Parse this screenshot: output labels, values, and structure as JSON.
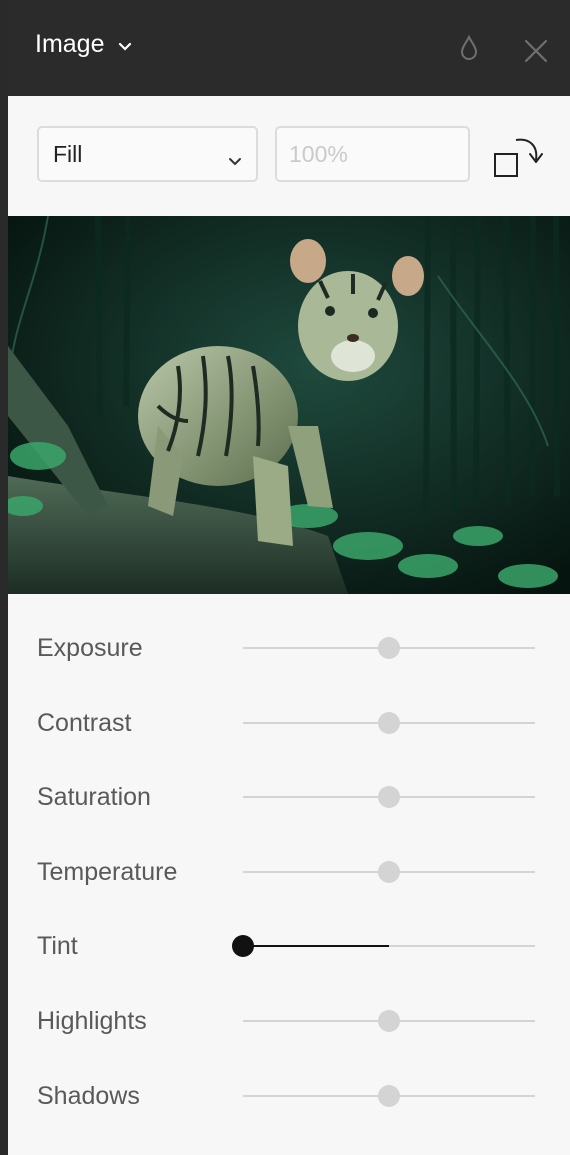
{
  "header": {
    "title": "Image",
    "icons": [
      "chevron-down-icon",
      "droplet-icon",
      "close-icon"
    ]
  },
  "controls": {
    "fill_mode": "Fill",
    "fill_options_visible": [
      "Fill"
    ],
    "percent_placeholder": "100%"
  },
  "adjustments": [
    {
      "label": "Exposure",
      "value": 0.5
    },
    {
      "label": "Contrast",
      "value": 0.5
    },
    {
      "label": "Saturation",
      "value": 0.5
    },
    {
      "label": "Temperature",
      "value": 0.5
    },
    {
      "label": "Tint",
      "value": 0.0,
      "active": true
    },
    {
      "label": "Highlights",
      "value": 0.5
    },
    {
      "label": "Shadows",
      "value": 0.5
    }
  ],
  "colors": {
    "header_bg": "#2b2b2b",
    "panel_bg": "#f7f7f7",
    "track": "#d4d4d4",
    "active": "#111111"
  }
}
